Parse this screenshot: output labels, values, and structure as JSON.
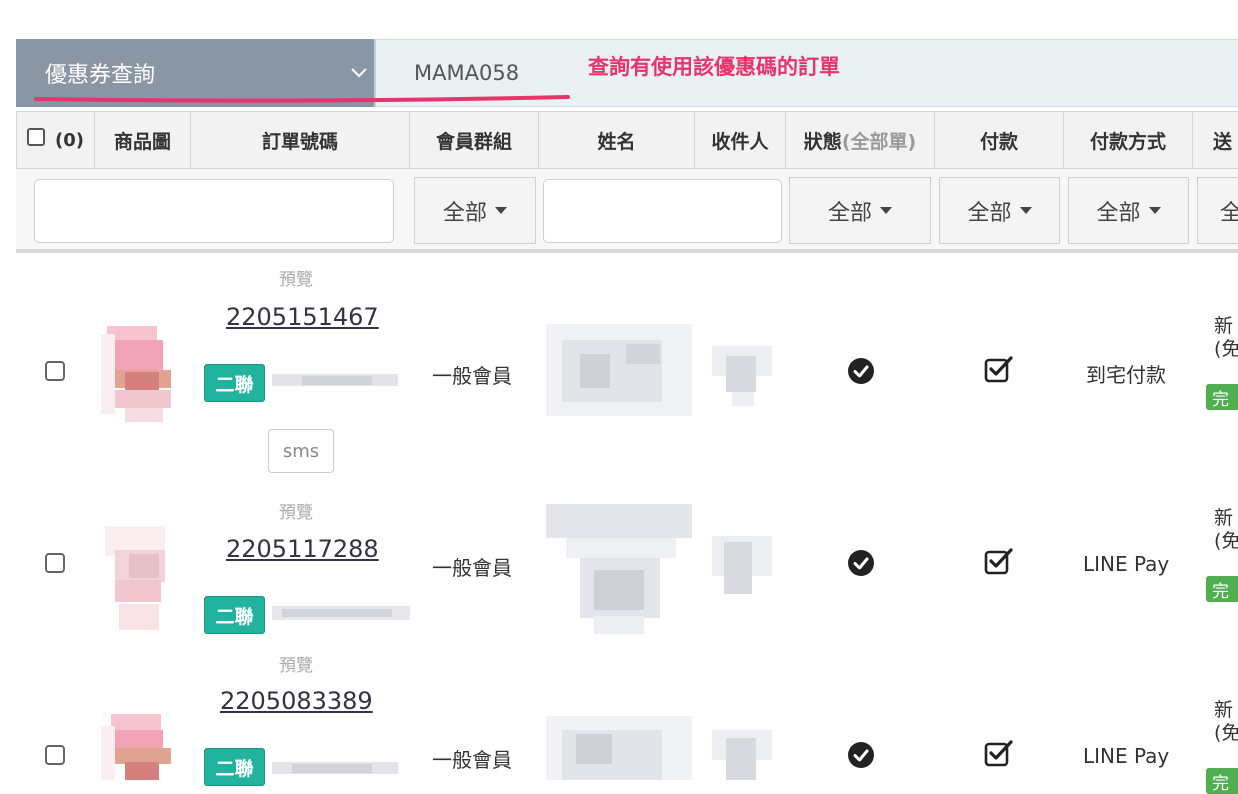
{
  "search": {
    "coupon_query_label": "優惠券查詢",
    "coupon_code": "MAMA058",
    "annotation": "查詢有使用該優惠碼的訂單",
    "annotation_color": "#e8336c"
  },
  "table": {
    "select_count": "(0)",
    "headers": {
      "image": "商品圖",
      "order_no": "訂單號碼",
      "member_group": "會員群組",
      "name": "姓名",
      "recipient": "收件人",
      "status": "狀態",
      "status_hint": "(全部單)",
      "payment": "付款",
      "payment_method": "付款方式",
      "shipping": "送"
    },
    "filters": {
      "member_group": "全部",
      "status": "全部",
      "payment": "全部",
      "payment_method": "全部",
      "shipping": "全"
    },
    "rows": [
      {
        "preview": "預覽",
        "order_no": "2205151467",
        "badge": "二聯",
        "sms": "sms",
        "member_group": "一般會員",
        "payment_method": "到宅付款",
        "shipping_line1": "新",
        "shipping_line2": "(免",
        "shipping_badge": "完"
      },
      {
        "preview": "預覽",
        "order_no": "2205117288",
        "badge": "二聯",
        "member_group": "一般會員",
        "payment_method": "LINE Pay",
        "shipping_line1": "新",
        "shipping_line2": "(免",
        "shipping_badge": "完"
      },
      {
        "preview": "預覽",
        "order_no": "2205083389",
        "badge": "二聯",
        "member_group": "一般會員",
        "payment_method": "LINE Pay",
        "shipping_line1": "新",
        "shipping_line2": "(免",
        "shipping_badge": "完"
      }
    ]
  },
  "colors": {
    "badge_teal": "#22b3a0",
    "status_green": "#4fae4f",
    "select_bg": "#8a96a3"
  }
}
